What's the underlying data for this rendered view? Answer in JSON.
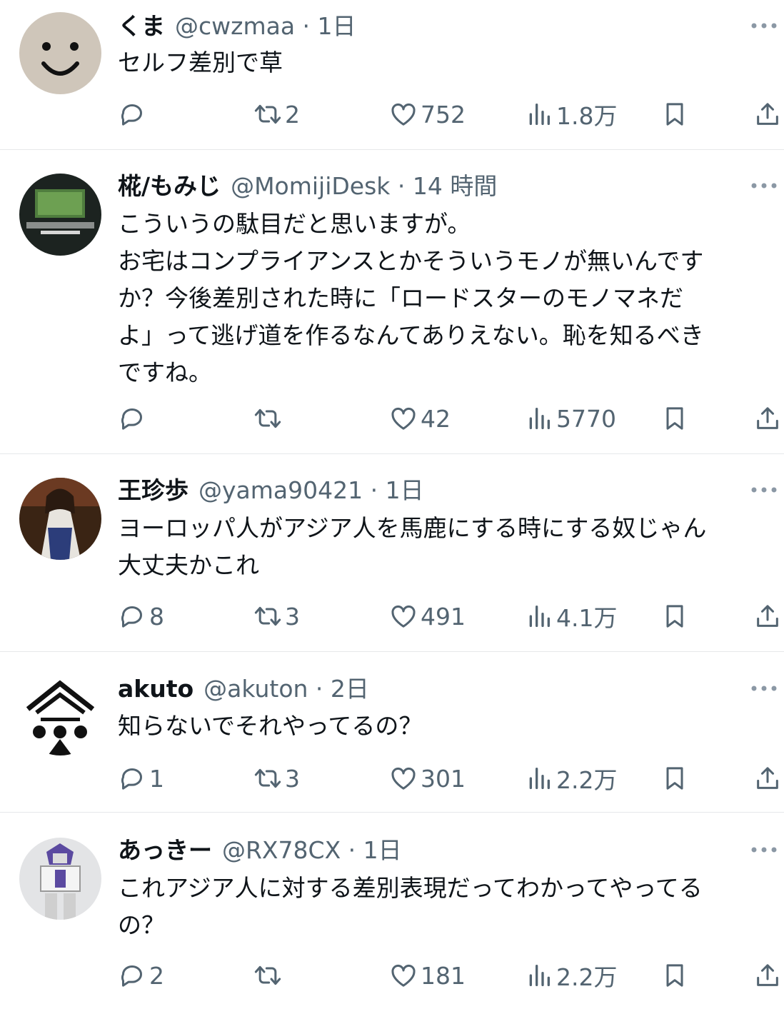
{
  "tweets": [
    {
      "name": "くま",
      "handle": "@cwzmaa",
      "time": "1日",
      "lines": [
        "セルフ差別で草"
      ],
      "replies": "",
      "retweets": "2",
      "likes": "752",
      "views": "1.8万"
    },
    {
      "name": "椛/もみじ",
      "handle": "@MomijiDesk",
      "time": "14 時間",
      "lines": [
        "こういうの駄目だと思いますが。",
        "お宅はコンプライアンスとかそういうモノが無いんです",
        "か？今後差別された時に「ロードスターのモノマネだ",
        "よ」って逃げ道を作るなんてありえない。恥を知るべき",
        "ですね。"
      ],
      "replies": "",
      "retweets": "",
      "likes": "42",
      "views": "5770"
    },
    {
      "name": "王珍歩",
      "handle": "@yama90421",
      "time": "1日",
      "lines": [
        "ヨーロッパ人がアジア人を馬鹿にする時にする奴じゃん",
        "大丈夫かこれ"
      ],
      "replies": "8",
      "retweets": "3",
      "likes": "491",
      "views": "4.1万"
    },
    {
      "name": "akuto",
      "handle": "@akuton",
      "time": "2日",
      "lines": [
        "知らないでそれやってるの？"
      ],
      "replies": "1",
      "retweets": "3",
      "likes": "301",
      "views": "2.2万"
    },
    {
      "name": "あっきー",
      "handle": "@RX78CX",
      "time": "1日",
      "lines": [
        "これアジア人に対する差別表現だってわかってやってる",
        "の？"
      ],
      "replies": "2",
      "retweets": "",
      "likes": "181",
      "views": "2.2万"
    }
  ],
  "icons": {
    "reply": "reply-icon",
    "retweet": "retweet-icon",
    "like": "heart-icon",
    "views": "views-icon",
    "bookmark": "bookmark-icon",
    "share": "share-icon",
    "more": "more-icon"
  },
  "colors": {
    "text": "#0f1419",
    "muted": "#536471",
    "divider": "#e6e8ea"
  }
}
